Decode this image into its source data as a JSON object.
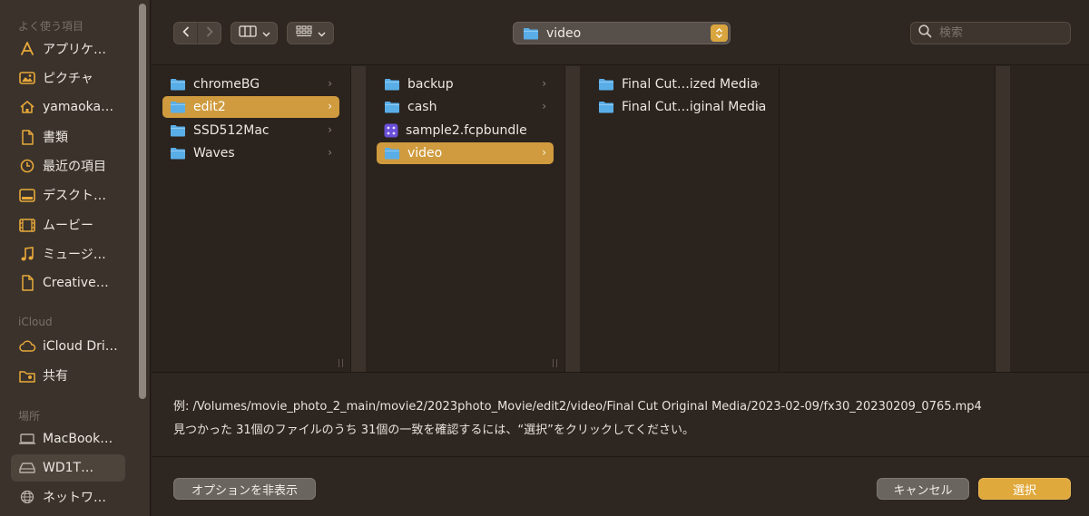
{
  "sidebar": {
    "sections": {
      "favorites": "よく使う項目",
      "icloud": "iCloud",
      "locations": "場所"
    },
    "favorites": [
      {
        "label": "アプリケ…",
        "icon": "applications-icon"
      },
      {
        "label": "ピクチャ",
        "icon": "pictures-icon"
      },
      {
        "label": "yamaoka…",
        "icon": "home-icon"
      },
      {
        "label": "書類",
        "icon": "document-icon"
      },
      {
        "label": "最近の項目",
        "icon": "clock-icon"
      },
      {
        "label": "デスクト…",
        "icon": "desktop-icon"
      },
      {
        "label": "ムービー",
        "icon": "movies-icon"
      },
      {
        "label": "ミュージ…",
        "icon": "music-icon"
      },
      {
        "label": "Creative…",
        "icon": "file-icon"
      }
    ],
    "icloud": [
      {
        "label": "iCloud Dri…",
        "icon": "cloud-icon"
      },
      {
        "label": "共有",
        "icon": "shared-folder-icon"
      }
    ],
    "locations": [
      {
        "label": "MacBook…",
        "icon": "laptop-icon"
      },
      {
        "label": "WD1T…",
        "icon": "drive-icon",
        "selected": true
      },
      {
        "label": "ネットワ…",
        "icon": "network-icon"
      }
    ]
  },
  "toolbar": {
    "path": "video",
    "search_placeholder": "検索"
  },
  "columns": [
    {
      "items": [
        {
          "label": "chromeBG",
          "type": "folder"
        },
        {
          "label": "edit2",
          "type": "folder",
          "selected": true
        },
        {
          "label": "SSD512Mac",
          "type": "folder"
        },
        {
          "label": "Waves",
          "type": "folder"
        }
      ]
    },
    {
      "items": [
        {
          "label": "backup",
          "type": "folder"
        },
        {
          "label": "cash",
          "type": "folder"
        },
        {
          "label": "sample2.fcpbundle",
          "type": "bundle"
        },
        {
          "label": "video",
          "type": "folder",
          "selected": true
        }
      ]
    },
    {
      "items": [
        {
          "label": "Final Cut…ized Media",
          "type": "folder"
        },
        {
          "label": "Final Cut…iginal Media",
          "type": "folder"
        }
      ]
    }
  ],
  "info": {
    "example_path": "例: /Volumes/movie_photo_2_main/movie2/2023photo_Movie/edit2/video/Final Cut Original Media/2023-02-09/fx30_20230209_0765.mp4",
    "match_text": "見つかった 31個のファイルのうち 31個の一致を確認するには、“選択”をクリックしてください。"
  },
  "buttons": {
    "hide_options": "オプションを非表示",
    "cancel": "キャンセル",
    "select": "選択"
  },
  "colors": {
    "accent": "#e0a93c",
    "folder": "#5aaee8",
    "selection": "#cf9b3e"
  }
}
